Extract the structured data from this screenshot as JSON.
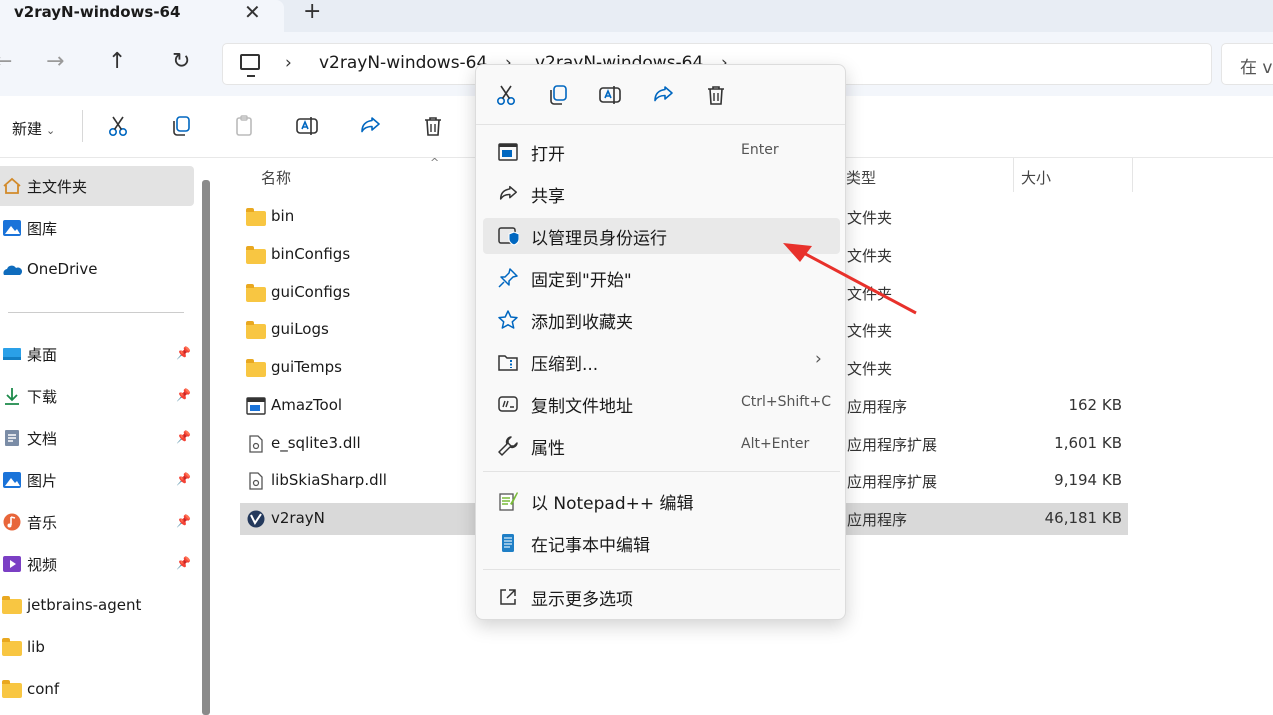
{
  "tab": {
    "title": "v2rayN-windows-64",
    "close": "✕",
    "add": "+"
  },
  "nav": {
    "back": "←",
    "forward": "→",
    "up": "↑",
    "refresh": "↻"
  },
  "address": {
    "sep": "›",
    "crumbs": [
      "v2rayN-windows-64",
      "v2rayN-windows-64"
    ],
    "search_placeholder": "在 v"
  },
  "toolbar": {
    "new_label": "新建",
    "new_chevron": "⌄"
  },
  "sidebar": {
    "items": [
      {
        "label": "主文件夹",
        "icon": "home-icon"
      },
      {
        "label": "图库",
        "icon": "gallery-icon"
      },
      {
        "label": "OneDrive",
        "icon": "onedrive-icon"
      },
      {
        "label": "桌面",
        "icon": "desktop-icon",
        "pinned": true
      },
      {
        "label": "下载",
        "icon": "download-icon",
        "pinned": true
      },
      {
        "label": "文档",
        "icon": "documents-icon",
        "pinned": true
      },
      {
        "label": "图片",
        "icon": "pictures-icon",
        "pinned": true
      },
      {
        "label": "音乐",
        "icon": "music-icon",
        "pinned": true
      },
      {
        "label": "视频",
        "icon": "videos-icon",
        "pinned": true
      },
      {
        "label": "jetbrains-agent",
        "icon": "folder-icon"
      },
      {
        "label": "lib",
        "icon": "folder-icon"
      },
      {
        "label": "conf",
        "icon": "folder-icon"
      }
    ],
    "pin_glyph": "📌"
  },
  "columns": {
    "name": "名称",
    "type": "类型",
    "size": "大小",
    "sort_caret": "^"
  },
  "files": [
    {
      "name": "bin",
      "type": "文件夹",
      "size": "",
      "icon": "folder-icon"
    },
    {
      "name": "binConfigs",
      "type": "文件夹",
      "size": "",
      "icon": "folder-icon"
    },
    {
      "name": "guiConfigs",
      "type": "文件夹",
      "size": "",
      "icon": "folder-icon"
    },
    {
      "name": "guiLogs",
      "type": "文件夹",
      "size": "",
      "icon": "folder-icon"
    },
    {
      "name": "guiTemps",
      "type": "文件夹",
      "size": "",
      "icon": "folder-icon"
    },
    {
      "name": "AmazTool",
      "type": "应用程序",
      "size": "162 KB",
      "icon": "app-icon"
    },
    {
      "name": "e_sqlite3.dll",
      "type": "应用程序扩展",
      "size": "1,601 KB",
      "icon": "dll-icon"
    },
    {
      "name": "libSkiaSharp.dll",
      "type": "应用程序扩展",
      "size": "9,194 KB",
      "icon": "dll-icon"
    },
    {
      "name": "v2rayN",
      "type": "应用程序",
      "size": "46,181 KB",
      "icon": "v2rayn-icon"
    }
  ],
  "context_menu": {
    "items": [
      {
        "label": "打开",
        "shortcut": "Enter",
        "icon": "open-icon"
      },
      {
        "label": "共享",
        "shortcut": "",
        "icon": "share-icon"
      },
      {
        "label": "以管理员身份运行",
        "shortcut": "",
        "icon": "shield-icon"
      },
      {
        "label": "固定到\"开始\"",
        "shortcut": "",
        "icon": "pin-icon"
      },
      {
        "label": "添加到收藏夹",
        "shortcut": "",
        "icon": "star-icon"
      },
      {
        "label": "压缩到...",
        "shortcut": "",
        "icon": "zip-icon",
        "chevron": "›"
      },
      {
        "label": "复制文件地址",
        "shortcut": "Ctrl+Shift+C",
        "icon": "copy-path-icon"
      },
      {
        "label": "属性",
        "shortcut": "Alt+Enter",
        "icon": "wrench-icon"
      },
      {
        "label": "以 Notepad++ 编辑",
        "shortcut": "",
        "icon": "notepadpp-icon"
      },
      {
        "label": "在记事本中编辑",
        "shortcut": "",
        "icon": "notepad-icon"
      },
      {
        "label": "显示更多选项",
        "shortcut": "",
        "icon": "more-options-icon"
      }
    ]
  },
  "colors": {
    "accent": "#0067c0",
    "arrow": "#e8312b",
    "folder": "#f8c642",
    "selected_row": "#d9d9d9"
  }
}
